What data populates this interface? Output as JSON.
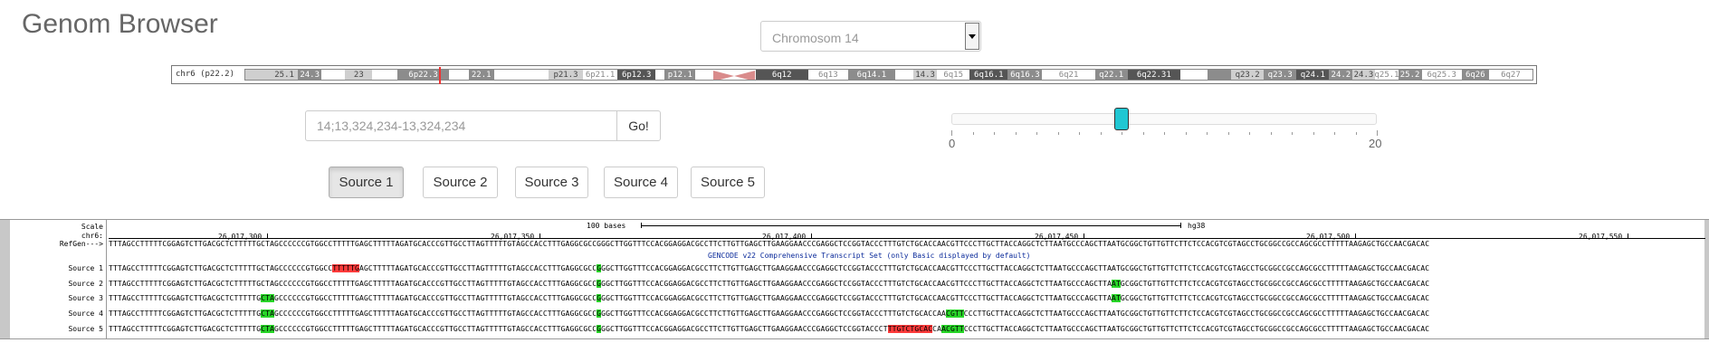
{
  "app": {
    "title": "Genom Browser"
  },
  "chromosome_select": {
    "value": "Chromosom 14"
  },
  "ideogram": {
    "label": "chr6 (p22.2)",
    "bands": [
      {
        "label": "",
        "shade": "light"
      },
      {
        "label": "25.1",
        "shade": "light"
      },
      {
        "label": "24.3",
        "shade": "mid"
      },
      {
        "label": "",
        "shade": "white"
      },
      {
        "label": "23",
        "shade": "light"
      },
      {
        "label": "",
        "shade": "white"
      },
      {
        "label": "6p22.3",
        "shade": "mid"
      },
      {
        "label": "",
        "shade": "white"
      },
      {
        "label": "22.1",
        "shade": "mid"
      },
      {
        "label": "",
        "shade": "white"
      },
      {
        "label": "p21.3",
        "shade": "light"
      },
      {
        "label": "6p21.1",
        "shade": "white"
      },
      {
        "label": "6p12.3",
        "shade": "dark"
      },
      {
        "label": "",
        "shade": "white"
      },
      {
        "label": "p12.1",
        "shade": "mid"
      },
      {
        "label": "",
        "shade": "white"
      },
      {
        "label": "6q12",
        "shade": "dark"
      },
      {
        "label": "6q13",
        "shade": "white"
      },
      {
        "label": "6q14.1",
        "shade": "mid"
      },
      {
        "label": "",
        "shade": "white"
      },
      {
        "label": "14.3",
        "shade": "light"
      },
      {
        "label": "6q15",
        "shade": "white"
      },
      {
        "label": "6q16.1",
        "shade": "dark"
      },
      {
        "label": "6q16.3",
        "shade": "mid"
      },
      {
        "label": "6q21",
        "shade": "white"
      },
      {
        "label": "q22.1",
        "shade": "mid"
      },
      {
        "label": "6q22.31",
        "shade": "dark"
      },
      {
        "label": "",
        "shade": "white"
      },
      {
        "label": "",
        "shade": "mid"
      },
      {
        "label": "q23.2",
        "shade": "light"
      },
      {
        "label": "q23.3",
        "shade": "mid"
      },
      {
        "label": "q24.1",
        "shade": "dark"
      },
      {
        "label": "24.2",
        "shade": "mid"
      },
      {
        "label": "24.3",
        "shade": "light"
      },
      {
        "label": "q25.1",
        "shade": "white"
      },
      {
        "label": "25.2",
        "shade": "mid"
      },
      {
        "label": "6q25.3",
        "shade": "white"
      },
      {
        "label": "6q26",
        "shade": "mid"
      },
      {
        "label": "6q27",
        "shade": "white"
      }
    ]
  },
  "search": {
    "value": "14;13,324,234-13,324,234",
    "go_label": "Go!"
  },
  "slider": {
    "min_label": "0",
    "max_label": "20",
    "value": 8,
    "min": 0,
    "max": 20
  },
  "sources": [
    {
      "label": "Source 1",
      "active": true
    },
    {
      "label": "Source 2",
      "active": false
    },
    {
      "label": "Source 3",
      "active": false
    },
    {
      "label": "Source 4",
      "active": false
    },
    {
      "label": "Source 5",
      "active": false
    }
  ],
  "track": {
    "scale_label": "Scale",
    "chrom_label": "chr6:",
    "refgene_label": "RefGen--->",
    "scale_text": "100 bases",
    "assembly": "hg38",
    "positions": [
      "26,017,300",
      "26,017,350",
      "26,017,400",
      "26,017,450",
      "26,017,500",
      "26,017,550"
    ],
    "gencode_text": "GENCODE v22 Comprehensive Transcript Set (only Basic displayed by default)",
    "reference_sequence": "TTTAGCCTTTTTCGGAGTCTTGACGCTCTTTTTGCTAGCCCCCCGTGGCCTTTTTGAGCTTTTTAGATGCACCCGTTGCCTTAGTTTTTGTAGCCACCTTTGAGGCGCCGGGCTTGGTTTCCACGGAGGACGCCTTCTTGTTGAGCTTGAAGGAACCCGAGGCTCCGGTACCCTTTGTCTGCACCAACGTTCCCTTGCTTACCAGGCTCTTAATGCCCAGCTTAATGCGGCTGTTGTTCTTCTCCACGTCGTAGCCTGCGGCCGCCAGCGCCTTTTTAAGAGCTGCCAACGACAC",
    "rows": [
      {
        "label": "Source 1",
        "sequence": "TTTAGCCTTTTTCGGAGTCTTGACGCTCTTTTTGCTAGCCCCCCGTGGCCTTTTTGAGCTTTTTAGATGCACCCGTTGCCTTAGTTTTTGTAGCCACCTTTGAGGCGCCGGGCTTGGTTTCCACGGAGGACGCCTTCTTGTTGAGCTTGAAGGAACCCGAGGCTCCGGTACCCTTTGTCTGCACCAACGTTCCCTTGCTTACCAGGCTCTTAATGCCCAGCTTAATGCGGCTGTTGTTCTTCTCCACGTCGTAGCCTGCGGCCGCCAGCGCCTTTTTAAGAGCTGCCAACGACAC",
        "highlights": [
          {
            "start": 50,
            "end": 56,
            "color": "red"
          },
          {
            "start": 109,
            "end": 110,
            "color": "green"
          }
        ]
      },
      {
        "label": "Source 2",
        "sequence": "TTTAGCCTTTTTCGGAGTCTTGACGCTCTTTTTGCTAGCCCCCCGTGGCCTTTTTGAGCTTTTTAGATGCACCCGTTGCCTTAGTTTTTGTAGCCACCTTTGAGGCGCCGGGCTTGGTTTCCACGGAGGACGCCTTCTTGTTGAGCTTGAAGGAACCCGAGGCTCCGGTACCCTTTGTCTGCACCAACGTTCCCTTGCTTACCAGGCTCTTAATGCCCAGCTTAATGCGGCTGTTGTTCTTCTCCACGTCGTAGCCTGCGGCCGCCAGCGCCTTTTTAAGAGCTGCCAACGACAC",
        "highlights": [
          {
            "start": 109,
            "end": 110,
            "color": "green"
          },
          {
            "start": 224,
            "end": 226,
            "color": "green"
          }
        ]
      },
      {
        "label": "Source 3",
        "sequence": "TTTAGCCTTTTTCGGAGTCTTGACGCTCTTTTTGCTAGCCCCCCGTGGCCTTTTTGAGCTTTTTAGATGCACCCGTTGCCTTAGTTTTTGTAGCCACCTTTGAGGCGCCGGGCTTGGTTTCCACGGAGGACGCCTTCTTGTTGAGCTTGAAGGAACCCGAGGCTCCGGTACCCTTTGTCTGCACCAACGTTCCCTTGCTTACCAGGCTCTTAATGCCCAGCTTAATGCGGCTGTTGTTCTTCTCCACGTCGTAGCCTGCGGCCGCCAGCGCCTTTTTAAGAGCTGCCAACGACAC",
        "highlights": [
          {
            "start": 34,
            "end": 37,
            "color": "green"
          },
          {
            "start": 109,
            "end": 110,
            "color": "green"
          },
          {
            "start": 224,
            "end": 226,
            "color": "green"
          }
        ]
      },
      {
        "label": "Source 4",
        "sequence": "TTTAGCCTTTTTCGGAGTCTTGACGCTCTTTTTGCTAGCCCCCCGTGGCCTTTTTGAGCTTTTTAGATGCACCCGTTGCCTTAGTTTTTGTAGCCACCTTTGAGGCGCCGGGCTTGGTTTCCACGGAGGACGCCTTCTTGTTGAGCTTGAAGGAACCCGAGGCTCCGGTACCCTTTGTCTGCACCAACGTTCCCTTGCTTACCAGGCTCTTAATGCCCAGCTTAATGCGGCTGTTGTTCTTCTCCACGTCGTAGCCTGCGGCCGCCAGCGCCTTTTTAAGAGCTGCCAACGACAC",
        "highlights": [
          {
            "start": 34,
            "end": 37,
            "color": "green"
          },
          {
            "start": 109,
            "end": 110,
            "color": "green"
          },
          {
            "start": 187,
            "end": 191,
            "color": "green"
          }
        ]
      },
      {
        "label": "Source 5",
        "sequence": "TTTAGCCTTTTTCGGAGTCTTGACGCTCTTTTTGCTAGCCCCCCGTGGCCTTTTTGAGCTTTTTAGATGCACCCGTTGCCTTAGTTTTTGTAGCCACCTTTGAGGCGCCGGGCTTGGTTTCCACGGAGGACGCCTTCTTGTTGAGCTTGAAGGAACCCGAGGCTCCGGTACCCTTTGTCTGCACCAACGTTCCCTTGCTTACCAGGCTCTTAATGCCCAGCTTAATGCGGCTGTTGTTCTTCTCCACGTCGTAGCCTGCGGCCGCCAGCGCCTTTTTAAGAGCTGCCAACGACAC",
        "highlights": [
          {
            "start": 34,
            "end": 37,
            "color": "green"
          },
          {
            "start": 109,
            "end": 110,
            "color": "green"
          },
          {
            "start": 174,
            "end": 184,
            "color": "red"
          },
          {
            "start": 186,
            "end": 191,
            "color": "green"
          }
        ]
      }
    ]
  },
  "colors": {
    "slider_handle": "#20c7d3",
    "highlight_red": "#ff3b3b",
    "highlight_green": "#28d628",
    "gencode_blue": "#0a2a9a"
  }
}
